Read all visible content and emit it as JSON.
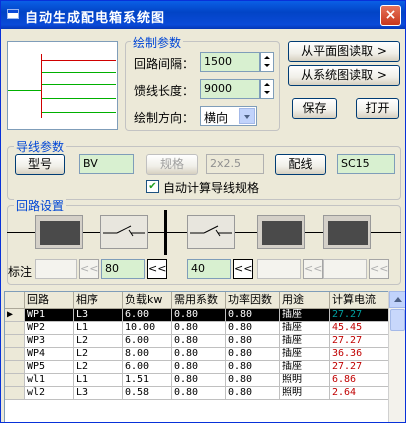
{
  "window": {
    "title": "自动生成配电箱系统图",
    "close": "×"
  },
  "draw_params": {
    "group_label": "绘制参数",
    "loop_spacing_label": "回路间隔：",
    "loop_spacing_value": "1500",
    "feeder_length_label": "馈线长度：",
    "feeder_length_value": "9000",
    "direction_label": "绘制方向：",
    "direction_value": "横向"
  },
  "buttons": {
    "read_plan": "从平面图读取 >",
    "read_system": "从系统图读取 >",
    "save": "保存",
    "open": "打开"
  },
  "wire_params": {
    "group_label": "导线参数",
    "model_button": "型号",
    "model_value": "BV",
    "spec_button": "规格",
    "spec_value": "2x2.5",
    "wiring_button": "配线",
    "wiring_value": "SC15",
    "auto_calc_label": "自动计算导线规格",
    "auto_calc_checked": true
  },
  "loop_settings": {
    "group_label": "回路设置",
    "annotation_label": "标注",
    "nav_prev": "<<",
    "field_1": "",
    "field_2": "80",
    "field_3": "40",
    "field_4": "",
    "field_5": ""
  },
  "table": {
    "columns": [
      "回路",
      "相序",
      "负载kw",
      "需用系数",
      "功率因数",
      "用途",
      "计算电流"
    ],
    "rows": [
      [
        "WP1",
        "L3",
        "6.00",
        "0.80",
        "0.80",
        "插座",
        "27.27"
      ],
      [
        "WP2",
        "L1",
        "10.00",
        "0.80",
        "0.80",
        "插座",
        "45.45"
      ],
      [
        "WP3",
        "L2",
        "6.00",
        "0.80",
        "0.80",
        "插座",
        "27.27"
      ],
      [
        "WP4",
        "L2",
        "8.00",
        "0.80",
        "0.80",
        "插座",
        "36.36"
      ],
      [
        "WP5",
        "L2",
        "6.00",
        "0.80",
        "0.80",
        "插座",
        "27.27"
      ],
      [
        "wl1",
        "L1",
        "1.51",
        "0.80",
        "0.80",
        "照明",
        "6.86"
      ],
      [
        "wl2",
        "L3",
        "0.58",
        "0.80",
        "0.80",
        "照明",
        "2.64"
      ]
    ],
    "current_colors": [
      "#00a0a0",
      "#c00000",
      "#c00000",
      "#c00000",
      "#c00000",
      "#c00000",
      "#c00000"
    ]
  }
}
